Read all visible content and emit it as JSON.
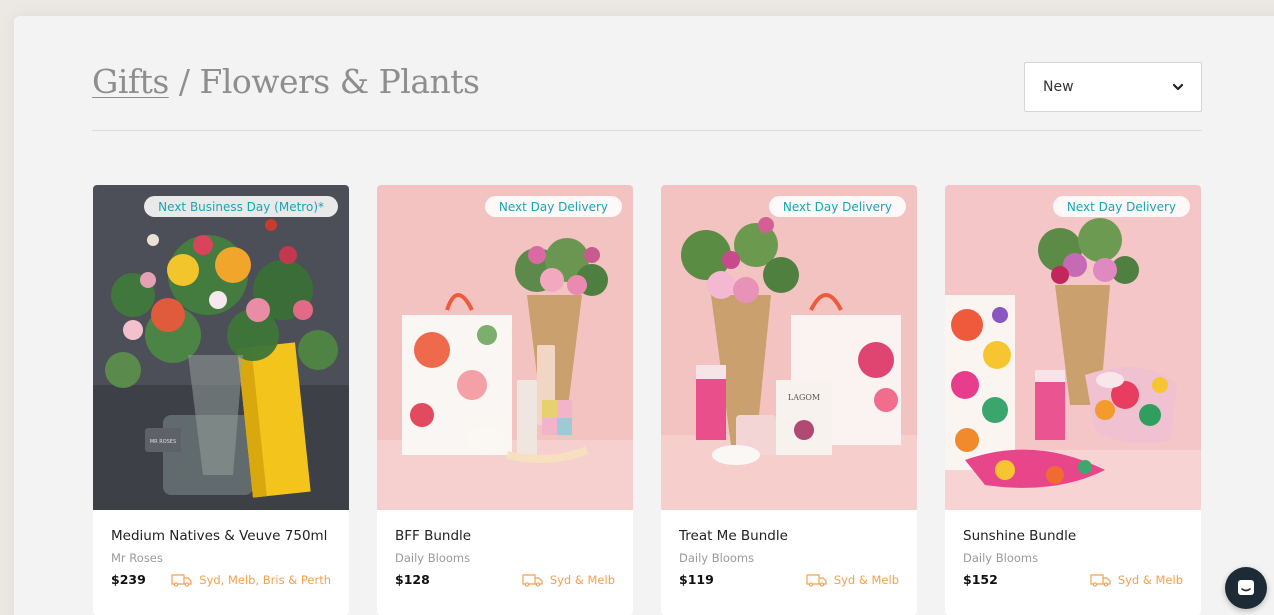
{
  "breadcrumb": {
    "link": "Gifts",
    "separator": " / ",
    "current": "Flowers & Plants"
  },
  "sort": {
    "selected": "New"
  },
  "products": [
    {
      "badge": "Next Business Day (Metro)*",
      "name": "Medium Natives & Veuve 750ml",
      "vendor": "Mr Roses",
      "price": "$239",
      "delivery": "Syd, Melb, Bris & Perth"
    },
    {
      "badge": "Next Day Delivery",
      "name": "BFF Bundle",
      "vendor": "Daily Blooms",
      "price": "$128",
      "delivery": "Syd & Melb"
    },
    {
      "badge": "Next Day Delivery",
      "name": "Treat Me Bundle",
      "vendor": "Daily Blooms",
      "price": "$119",
      "delivery": "Syd & Melb"
    },
    {
      "badge": "Next Day Delivery",
      "name": "Sunshine Bundle",
      "vendor": "Daily Blooms",
      "price": "$152",
      "delivery": "Syd & Melb"
    }
  ],
  "photo_labels": {
    "product_1_box": "MR ROSES",
    "product_3_card": "LAGOM"
  },
  "colors": {
    "badge_text": "#1aa5b2",
    "delivery_text": "#f5a04d",
    "pink_background": "#f5c8c6",
    "dark_background": "#4a4d55",
    "chat_button": "#1d2b36"
  },
  "icons": [
    "chevron-down-icon",
    "truck-icon",
    "chat-icon"
  ]
}
